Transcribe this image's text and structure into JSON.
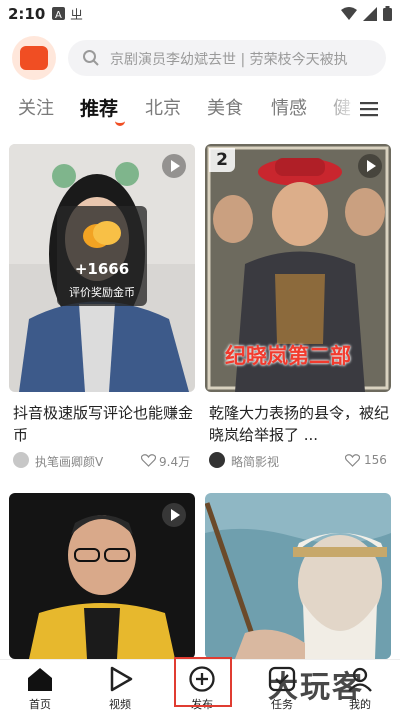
{
  "status": {
    "time": "2:10"
  },
  "search": {
    "placeholder": "京剧演员李幼斌去世 | 劳荣枝今天被执"
  },
  "tabs": [
    "关注",
    "推荐",
    "北京",
    "美食",
    "情感",
    "健"
  ],
  "cards": [
    {
      "title": "抖音极速版写评论也能赚金币",
      "author": "执笔画卿颜V",
      "likes": "9.4万",
      "overlay": {
        "count": "+1666",
        "caption": "评价奖励金币"
      }
    },
    {
      "title": "乾隆大力表扬的县令，被纪晓岚给举报了 ...",
      "author": "略简影视",
      "likes": "156",
      "badge": "2",
      "caption_banner": "纪晓岚第二部"
    },
    {
      "title": "",
      "author": "",
      "likes": ""
    },
    {
      "title": "",
      "author": "",
      "likes": ""
    }
  ],
  "nav": [
    {
      "label": "首页",
      "icon": "home-icon"
    },
    {
      "label": "视频",
      "icon": "play-icon"
    },
    {
      "label": "发布",
      "icon": "plus-icon"
    },
    {
      "label": "任务",
      "icon": "task-icon"
    },
    {
      "label": "我的",
      "icon": "profile-icon"
    }
  ],
  "watermark": "大玩客",
  "colors": {
    "accent": "#f04e23",
    "highlight": "#e03c31"
  }
}
